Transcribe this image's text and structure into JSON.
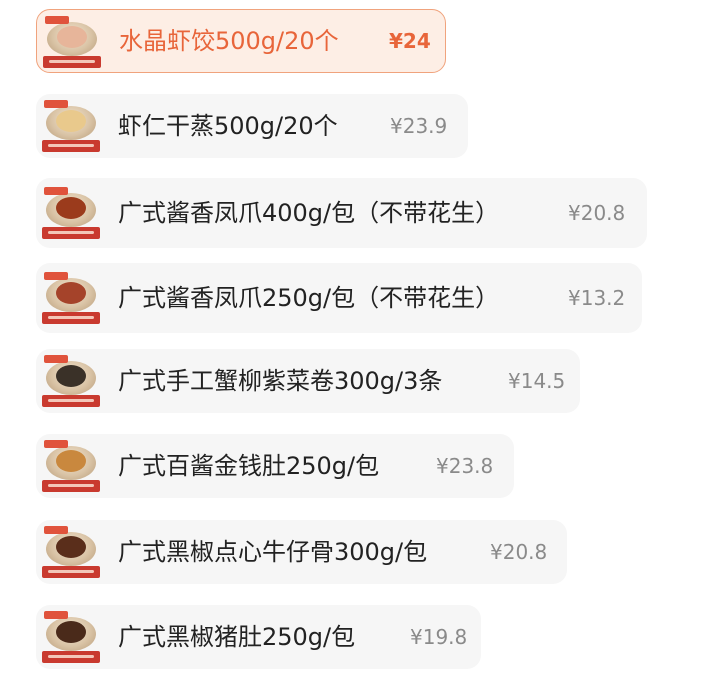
{
  "colors": {
    "accent": "#e8653a",
    "selected_bg": "#fdeee5",
    "item_bg": "#f6f6f6",
    "price_gray": "#8a8a8a"
  },
  "items": [
    {
      "name": "水晶虾饺500g/20个",
      "price": "¥24",
      "selected": true,
      "icon": "dumpling-dish-thumbnail",
      "food_color": "#e7b59a"
    },
    {
      "name": "虾仁干蒸500g/20个",
      "price": "¥23.9",
      "selected": false,
      "icon": "siumai-dish-thumbnail",
      "food_color": "#e9c98c"
    },
    {
      "name": "广式酱香凤爪400g/包（不带花生）",
      "price": "¥20.8",
      "selected": false,
      "icon": "chicken-feet-dish-thumbnail",
      "food_color": "#9b3b1c"
    },
    {
      "name": "广式酱香凤爪250g/包（不带花生）",
      "price": "¥13.2",
      "selected": false,
      "icon": "chicken-feet-dish-thumbnail",
      "food_color": "#a5432a"
    },
    {
      "name": "广式手工蟹柳紫菜卷300g/3条",
      "price": "¥14.5",
      "selected": false,
      "icon": "seaweed-roll-dish-thumbnail",
      "food_color": "#3a3128"
    },
    {
      "name": "广式百酱金钱肚250g/包",
      "price": "¥23.8",
      "selected": false,
      "icon": "tripe-dish-thumbnail",
      "food_color": "#c9883e"
    },
    {
      "name": "广式黑椒点心牛仔骨300g/包",
      "price": "¥20.8",
      "selected": false,
      "icon": "beef-rib-dish-thumbnail",
      "food_color": "#5a2e1b"
    },
    {
      "name": "广式黑椒猪肚250g/包",
      "price": "¥19.8",
      "selected": false,
      "icon": "pork-tripe-dish-thumbnail",
      "food_color": "#4a2a1a"
    }
  ]
}
